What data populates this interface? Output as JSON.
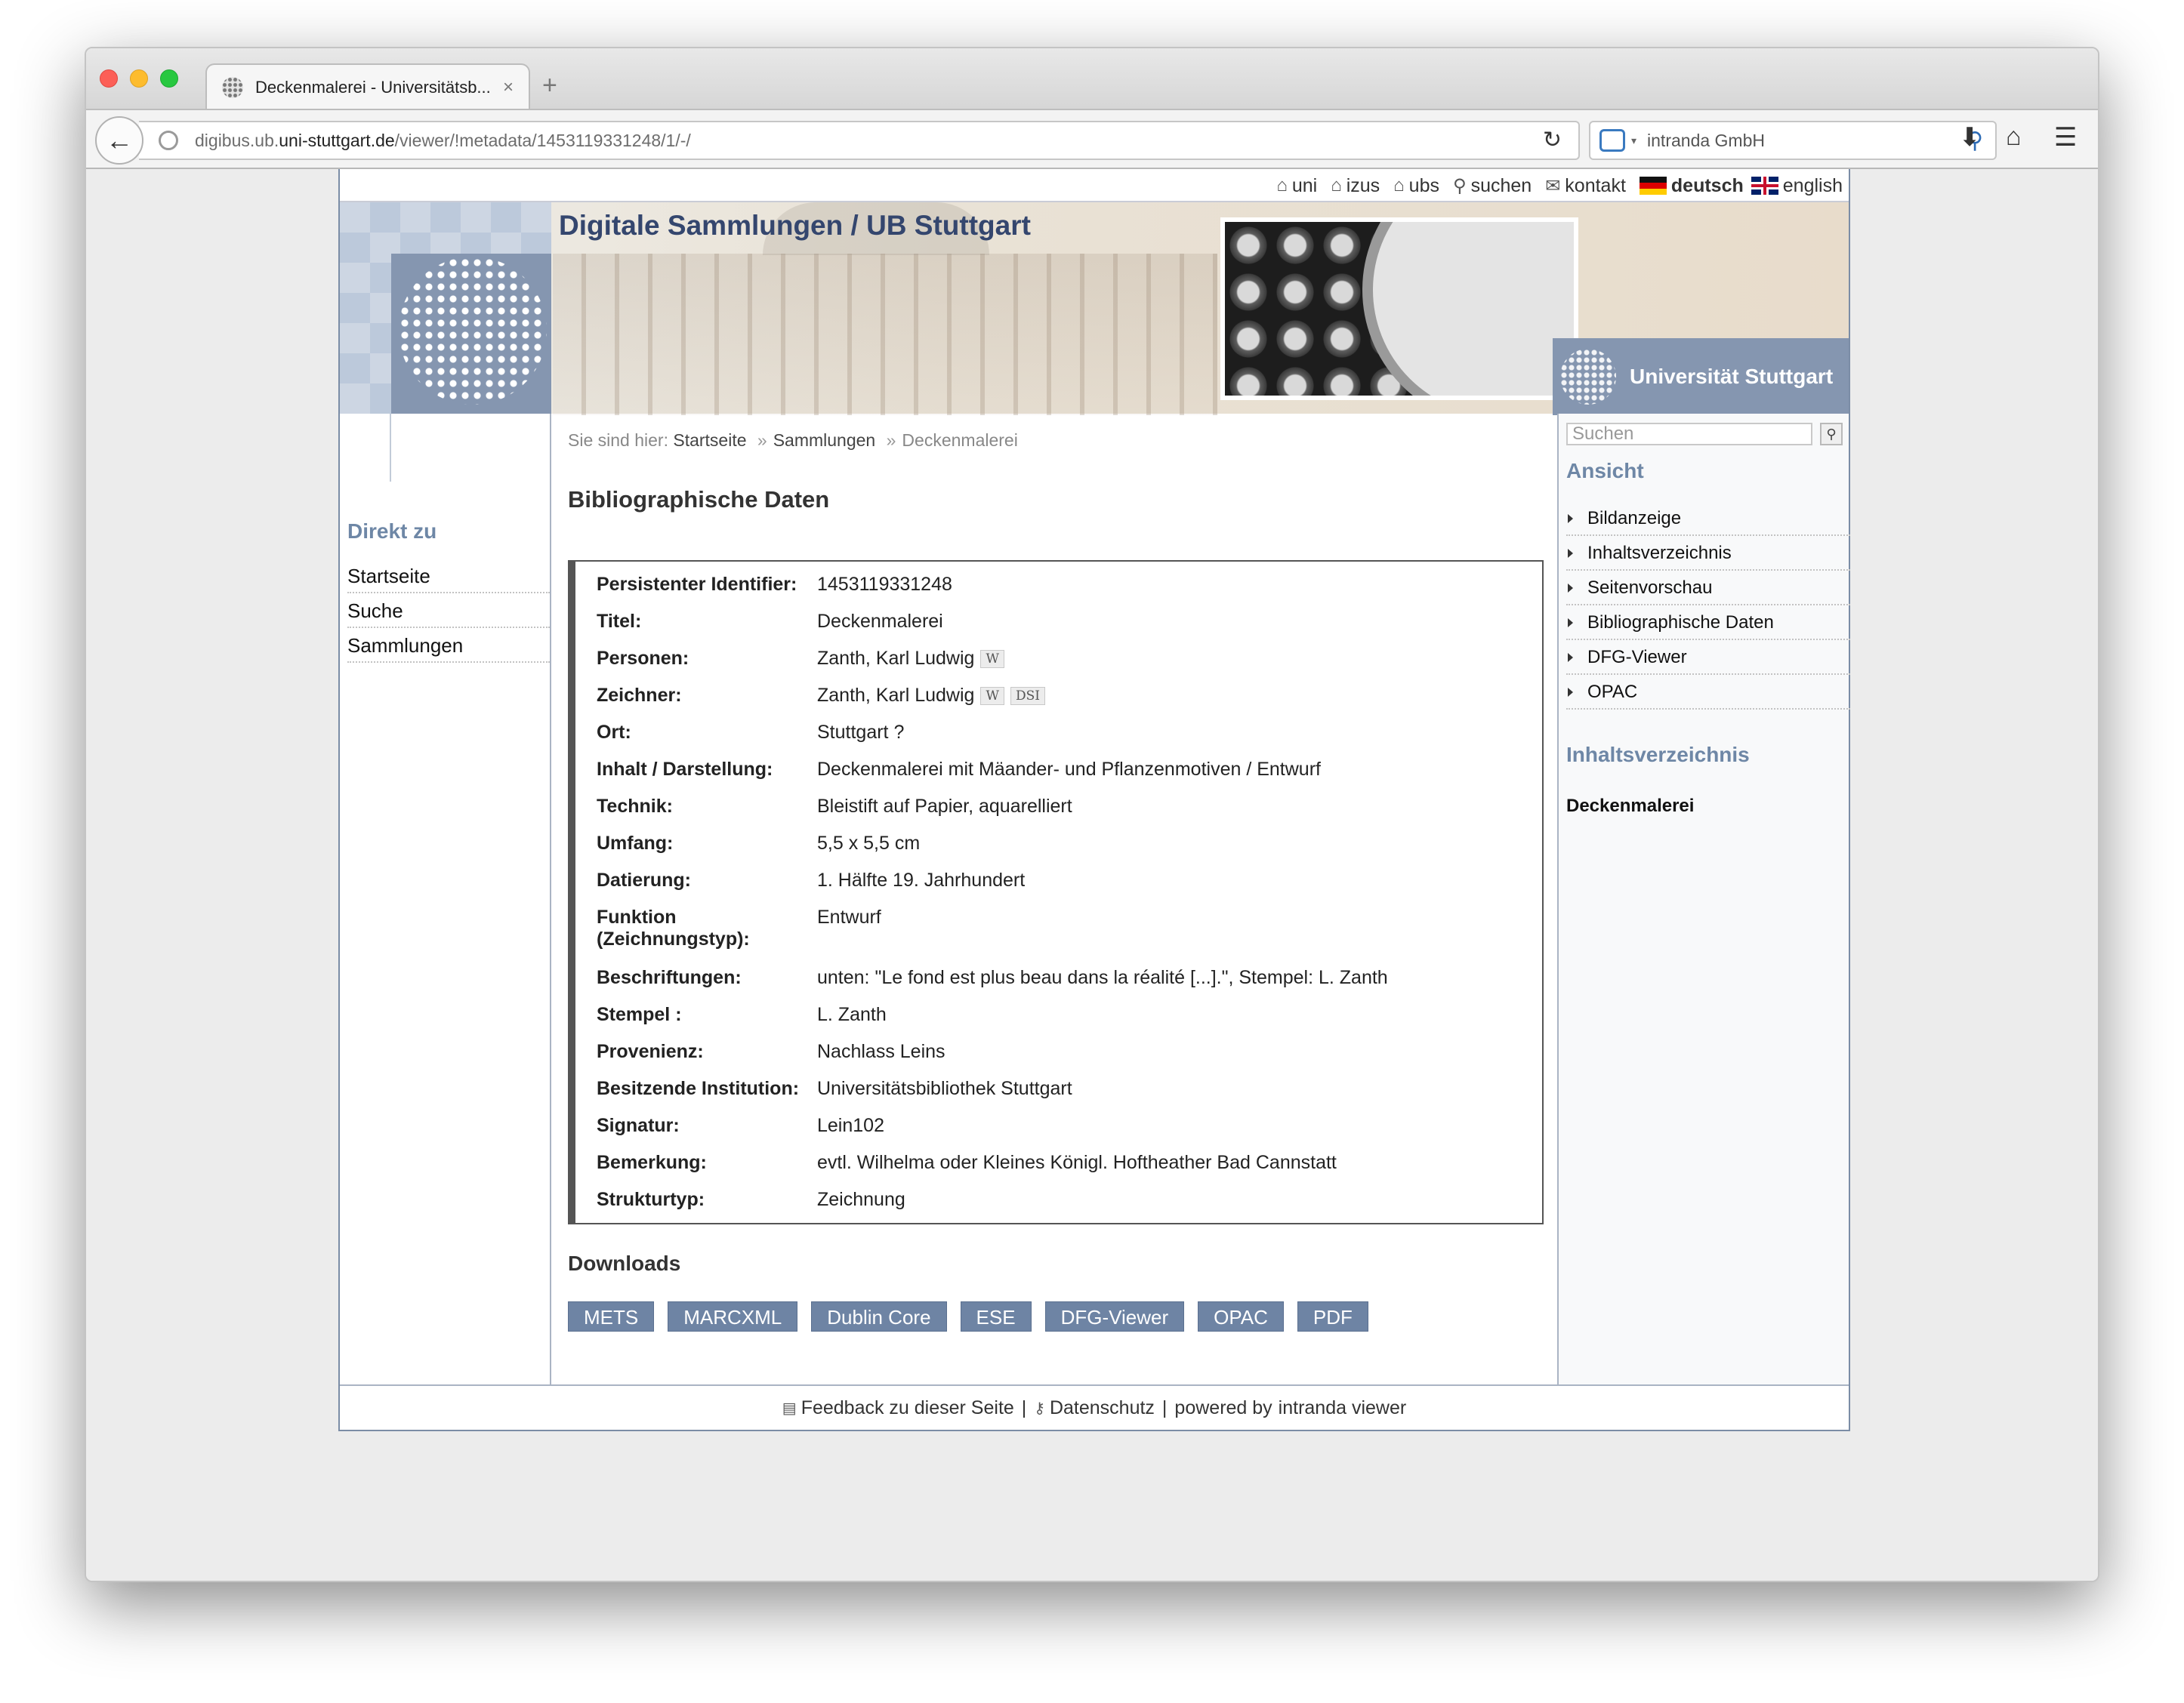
{
  "browser": {
    "tab_title": "Deckenmalerei - Universitätsb...",
    "tab_close": "×",
    "new_tab": "+",
    "url_prefix": "digibus.ub.",
    "url_domain": "uni-stuttgart.de",
    "url_path": "/viewer/!metadata/1453119331248/1/-/",
    "search_engine": "intranda GmbH",
    "icons": [
      "back-arrow-icon",
      "globe-icon",
      "reload-icon",
      "search-engine-icon",
      "magnifier-icon",
      "download-icon",
      "home-icon",
      "menu-icon"
    ]
  },
  "toplinks": {
    "uni": "uni",
    "izus": "izus",
    "ubs": "ubs",
    "suchen": "suchen",
    "kontakt": "kontakt",
    "deutsch": "deutsch",
    "english": "english"
  },
  "header": {
    "site_title": "Digitale Sammlungen / UB Stuttgart",
    "university": "Universität Stuttgart"
  },
  "left": {
    "heading": "Direkt zu",
    "items": [
      "Startseite",
      "Suche",
      "Sammlungen"
    ]
  },
  "breadcrumb": {
    "prefix": "Sie sind hier:",
    "items": [
      "Startseite",
      "Sammlungen",
      "Deckenmalerei"
    ],
    "sep": "»"
  },
  "main": {
    "heading": "Bibliographische Daten",
    "metadata": [
      {
        "label": "Persistenter Identifier:",
        "value": "1453119331248"
      },
      {
        "label": "Titel:",
        "value": "Deckenmalerei"
      },
      {
        "label": "Personen:",
        "value": "Zanth, Karl Ludwig"
      },
      {
        "label": "Zeichner:",
        "value": "Zanth, Karl Ludwig"
      },
      {
        "label": "Ort:",
        "value": "Stuttgart ?"
      },
      {
        "label": "Inhalt / Darstellung:",
        "value": "Deckenmalerei mit Mäander- und Pflanzenmotiven / Entwurf"
      },
      {
        "label": "Technik:",
        "value": "Bleistift auf Papier, aquarelliert"
      },
      {
        "label": "Umfang:",
        "value": "5,5 x 5,5 cm"
      },
      {
        "label": "Datierung:",
        "value": "1. Hälfte 19. Jahrhundert"
      },
      {
        "label": "Funktion (Zeichnungstyp):",
        "value": "Entwurf"
      },
      {
        "label": "Beschriftungen:",
        "value": "unten: \"Le fond est plus beau dans la réalité [...].\", Stempel: L. Zanth"
      },
      {
        "label": "Stempel :",
        "value": "L. Zanth"
      },
      {
        "label": "Provenienz:",
        "value": "Nachlass Leins"
      },
      {
        "label": "Besitzende Institution:",
        "value": "Universitätsbibliothek Stuttgart"
      },
      {
        "label": "Signatur:",
        "value": "Lein102"
      },
      {
        "label": "Bemerkung:",
        "value": "evtl. Wilhelma oder Kleines Königl. Hoftheather Bad Cannstatt"
      },
      {
        "label": "Strukturtyp:",
        "value": "Zeichnung"
      }
    ],
    "badge_w": "W",
    "badge_dsi": "DSI",
    "downloads_heading": "Downloads",
    "downloads": [
      "METS",
      "MARCXML",
      "Dublin Core",
      "ESE",
      "DFG-Viewer",
      "OPAC",
      "PDF"
    ]
  },
  "right": {
    "search_placeholder": "Suchen",
    "ansicht_heading": "Ansicht",
    "ansicht_items": [
      "Bildanzeige",
      "Inhaltsverzeichnis",
      "Seitenvorschau",
      "Bibliographische Daten",
      "DFG-Viewer",
      "OPAC"
    ],
    "toc_heading": "Inhaltsverzeichnis",
    "toc_entry": "Deckenmalerei"
  },
  "footer": {
    "feedback": "Feedback zu dieser Seite",
    "datenschutz": "Datenschutz",
    "powered_by": "powered by",
    "viewer": "intranda viewer",
    "sep": "|"
  }
}
